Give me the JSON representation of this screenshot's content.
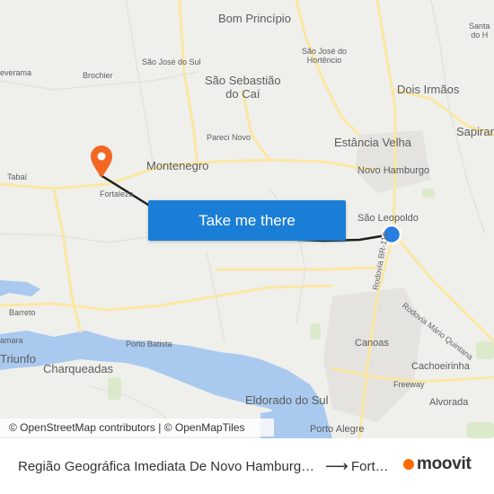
{
  "map": {
    "places": {
      "bom_principio": "Bom Princípio",
      "sao_jose_do_sul": "São José do Sul",
      "sao_jose_do_hortencio": "São José do\nHortêncio",
      "santa_do_h": "Santa\ndo H",
      "everama": "everama",
      "brochier": "Brochier",
      "sao_sebastiao_do_cai": "São Sebastião\ndo Caí",
      "dois_irmaos": "Dois Irmãos",
      "sapiran": "Sapiran",
      "pareci_novo": "Pareci Novo",
      "estancia_velha": "Estância Velha",
      "montenegro": "Montenegro",
      "novo_hamburgo": "Novo Hamburgo",
      "tabai": "Tabaí",
      "fortaleza": "Fortaleza",
      "sao_leopoldo": "São Leopoldo",
      "barreto": "Barreto",
      "amara": "amara",
      "triunfo": "Triunfo",
      "porto_batista": "Porto Batista",
      "charqueadas": "Charqueadas",
      "canoas": "Canoas",
      "cachoeirinha": "Cachoeirinha",
      "freeway": "Freeway",
      "alvorada": "Alvorada",
      "eldorado_do_sul": "Eldorado do Sul",
      "porto_alegre": "Porto Alegre"
    },
    "roads": {
      "br116": "Rodovia BR-116",
      "mario_quintana": "Rodovia Mário Quintana"
    },
    "colors": {
      "route": "#1f1f1f",
      "origin_marker": "#2a7de1",
      "destination_marker": "#f26722",
      "water": "#a9c9ee",
      "road": "#fbe7a3"
    }
  },
  "cta": {
    "label": "Take me there"
  },
  "attribution": {
    "osm": "© OpenStreetMap contributors",
    "sep": " | ",
    "omt": "© OpenMapTiles"
  },
  "footer": {
    "from": "Região Geográfica Imediata De Novo Hamburgo - São Leopoldo",
    "arrow": "⟶",
    "to": "Fortaleza",
    "brand": "moovit"
  }
}
